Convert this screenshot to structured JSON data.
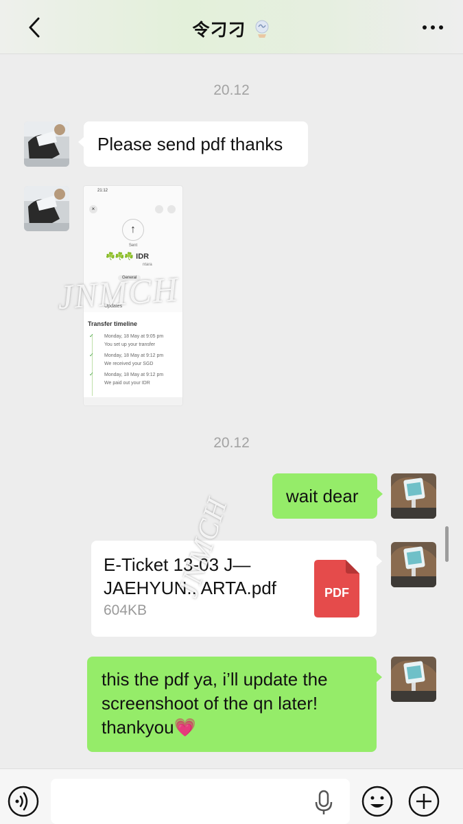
{
  "header": {
    "title": "令刁刁",
    "title_emoji": "crystal-ball-emoji"
  },
  "messages": {
    "timestamp_1": "20.12",
    "msg_1": "Please send pdf thanks",
    "timestamp_2": "20.12",
    "msg_3": "wait dear",
    "file": {
      "name": "E-Ticket 13-03 J— JAEHYUN.. ARTA.pdf",
      "size": "604KB",
      "type_label": "PDF"
    },
    "msg_5": "this the pdf ya, i’ll update the screenshoot of the qn later! thankyou💗"
  },
  "screenshot_thumb": {
    "status_time": "21:12",
    "sent_label": "Sent",
    "amount": "☘️☘️☘️ IDR",
    "recipient_fragment": "ntara",
    "tag": "General",
    "updates_label": "Updates",
    "timeline_title": "Transfer timeline",
    "timeline": [
      {
        "date": "Monday, 18 May at 9:05 pm",
        "text": "You set up your transfer"
      },
      {
        "date": "Monday, 18 May at 9:12 pm",
        "text": "We received your SGD"
      },
      {
        "date": "Monday, 18 May at 9:12 pm",
        "text": "We paid out your IDR"
      }
    ]
  },
  "watermarks": [
    "JNMCH",
    "JNMCH"
  ],
  "colors": {
    "background": "#ededed",
    "green_bubble": "#95ec69",
    "white_bubble": "#ffffff",
    "pdf_red": "#e54b4b",
    "timestamp": "#a3a3a3"
  },
  "icons": [
    "back-icon",
    "more-icon",
    "voice-icon",
    "mic-icon",
    "emoji-icon",
    "plus-icon",
    "pdf-file-icon"
  ]
}
